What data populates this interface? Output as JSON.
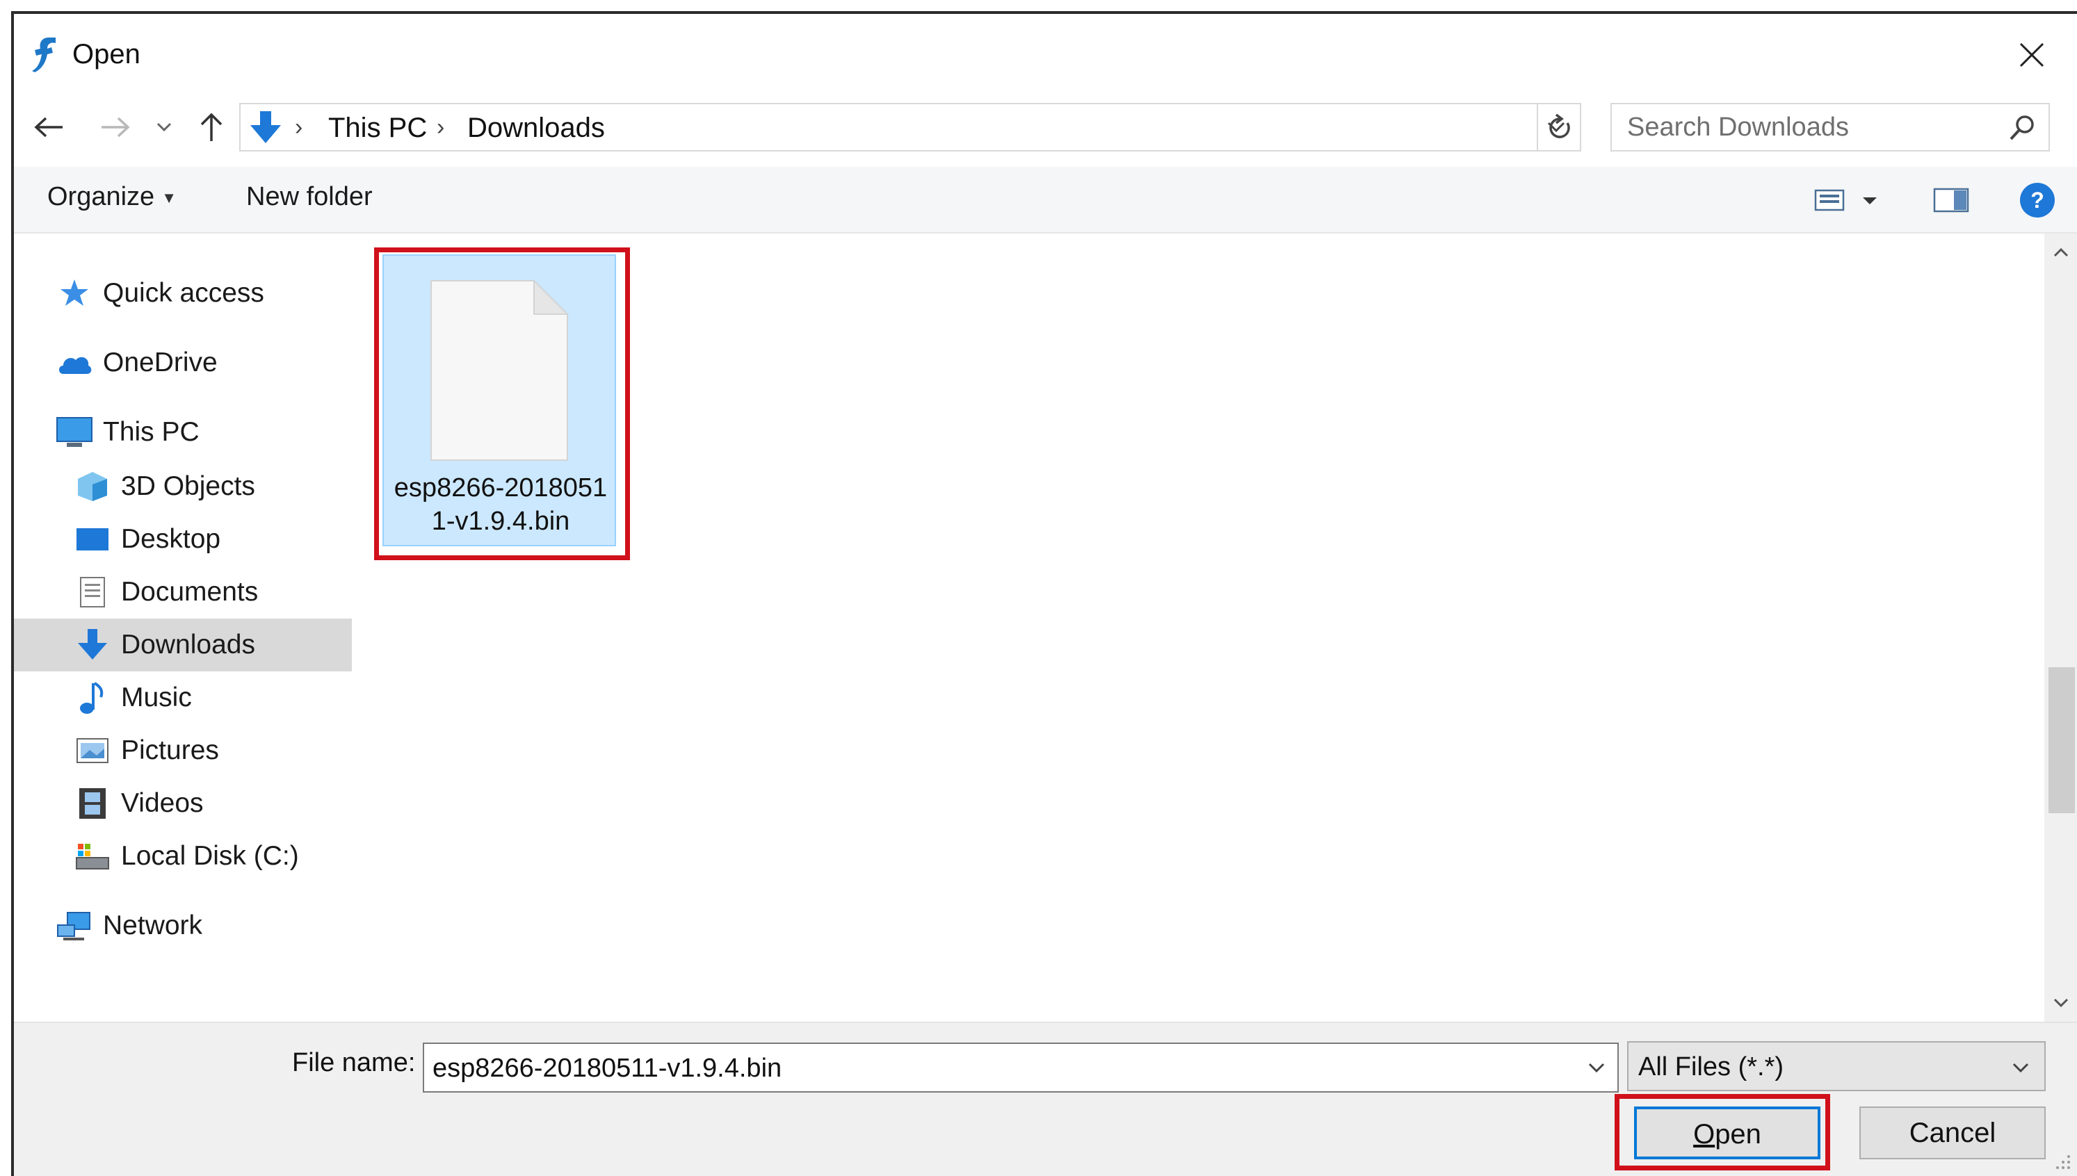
{
  "window": {
    "title": "Open",
    "close_label": "×"
  },
  "address": {
    "crumbs": [
      "This PC",
      "Downloads"
    ],
    "search_placeholder": "Search Downloads"
  },
  "commands": {
    "organize": "Organize",
    "new_folder": "New folder"
  },
  "nav": {
    "items": [
      {
        "label": "Quick access",
        "icon": "star-icon"
      },
      {
        "label": "OneDrive",
        "icon": "cloud-icon"
      },
      {
        "label": "This PC",
        "icon": "computer-icon"
      },
      {
        "label": "3D Objects",
        "icon": "cube-icon"
      },
      {
        "label": "Desktop",
        "icon": "desktop-icon"
      },
      {
        "label": "Documents",
        "icon": "documents-icon"
      },
      {
        "label": "Downloads",
        "icon": "download-icon",
        "selected": true
      },
      {
        "label": "Music",
        "icon": "music-icon"
      },
      {
        "label": "Pictures",
        "icon": "pictures-icon"
      },
      {
        "label": "Videos",
        "icon": "videos-icon"
      },
      {
        "label": "Local Disk (C:)",
        "icon": "disk-icon"
      },
      {
        "label": "Network",
        "icon": "network-icon"
      }
    ]
  },
  "files": [
    {
      "name": "esp8266-20180511-v1.9.4.bin",
      "selected": true
    }
  ],
  "footer": {
    "file_name_label": "File name:",
    "file_name_value": "esp8266-20180511-v1.9.4.bin",
    "file_type": "All Files (*.*)",
    "open_label": "Open",
    "cancel_label": "Cancel"
  },
  "colors": {
    "highlight": "#d0111b",
    "selection": "#cce8ff",
    "accent": "#0078d7"
  }
}
